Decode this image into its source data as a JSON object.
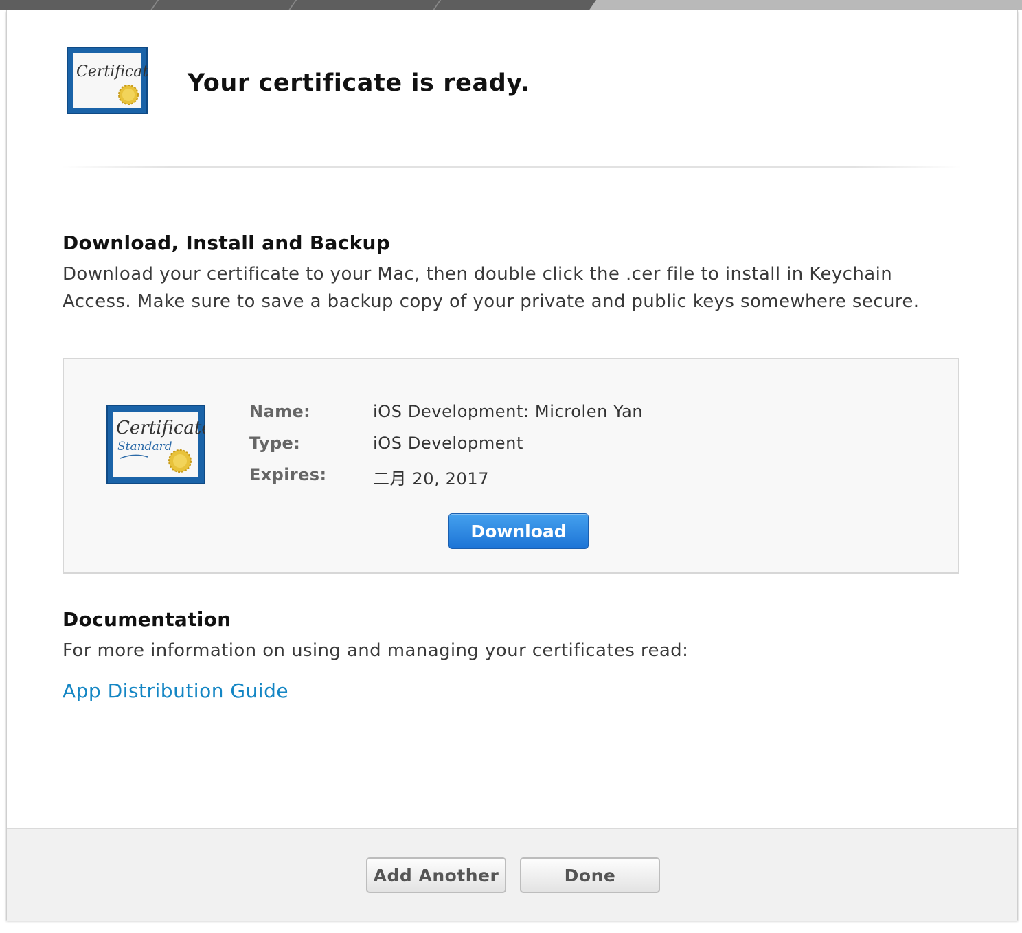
{
  "header": {
    "title": "Your certificate is ready.",
    "icon": "certificate-icon"
  },
  "download_section": {
    "heading": "Download, Install and Backup",
    "description": "Download your certificate to your Mac, then double click the .cer file to install in Keychain Access. Make sure to save a backup copy of your private and public keys somewhere secure."
  },
  "certificate": {
    "icon": "certificate-standard-icon",
    "name_label": "Name:",
    "name_value": "iOS Development: Microlen Yan",
    "type_label": "Type:",
    "type_value": "iOS Development",
    "expires_label": "Expires:",
    "expires_value": "二月 20, 2017",
    "download_label": "Download"
  },
  "documentation": {
    "heading": "Documentation",
    "description": "For more information on using and managing your certificates read:",
    "link_text": "App Distribution Guide"
  },
  "footer": {
    "add_another_label": "Add Another",
    "done_label": "Done"
  },
  "icon_text": {
    "certificate_script": "Certificate",
    "standard_script": "Standard"
  },
  "colors": {
    "link": "#1486c4",
    "primary_button": "#1d74d6",
    "certificate_border": "#1a63a8"
  }
}
